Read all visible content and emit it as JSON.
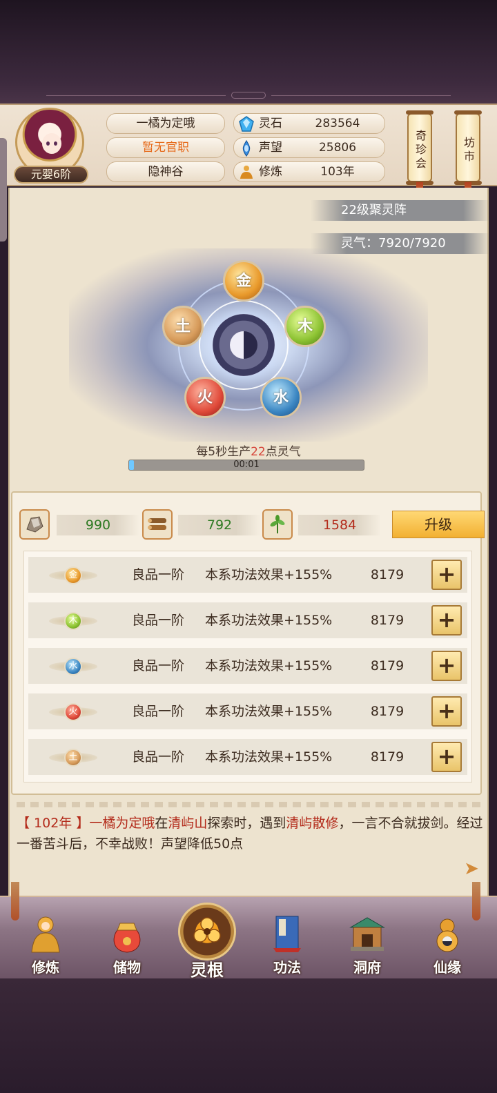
{
  "player": {
    "name": "一橘为定哦",
    "official_title": "暂无官职",
    "sect": "隐神谷",
    "rank": "元婴6阶"
  },
  "resources": [
    {
      "label": "灵石",
      "value": "283564",
      "icon": "spirit-stone-icon"
    },
    {
      "label": "声望",
      "value": "25806",
      "icon": "reputation-icon"
    },
    {
      "label": "修炼",
      "value": "103年",
      "icon": "meditation-icon"
    }
  ],
  "scrolls": {
    "treasure_shop": "奇珍会",
    "market": "坊市"
  },
  "array": {
    "level_label": "22级聚灵阵",
    "qi_label": "灵气：7920/7920",
    "production_prefix": "每5秒生产",
    "production_amount": "22",
    "production_suffix": "点灵气",
    "timer": "00:01",
    "progress": 0.02
  },
  "elements": {
    "gold": "金",
    "wood": "木",
    "water": "水",
    "fire": "火",
    "earth": "土"
  },
  "materials": [
    {
      "value": "990",
      "icon": "ore-icon"
    },
    {
      "value": "792",
      "icon": "wood-log-icon"
    },
    {
      "value": "1584",
      "icon": "herb-icon"
    }
  ],
  "upgrade_label": "升级",
  "element_rows": [
    {
      "element": "金",
      "grade": "良品一阶",
      "effect": "本系功法效果+155%",
      "cost": "8179"
    },
    {
      "element": "木",
      "grade": "良品一阶",
      "effect": "本系功法效果+155%",
      "cost": "8179"
    },
    {
      "element": "水",
      "grade": "良品一阶",
      "effect": "本系功法效果+155%",
      "cost": "8179"
    },
    {
      "element": "火",
      "grade": "良品一阶",
      "effect": "本系功法效果+155%",
      "cost": "8179"
    },
    {
      "element": "土",
      "grade": "良品一阶",
      "effect": "本系功法效果+155%",
      "cost": "8179"
    }
  ],
  "plus_label": "+",
  "log": {
    "year": "【 102年 】",
    "actor": "一橘为定哦",
    "t1": "在",
    "place": "清屿山",
    "t2": "探索时，遇到",
    "enemy": "清屿散修",
    "t3": "，一言不合就拔剑。经过一番苦斗后，不幸战败！声望降低50点"
  },
  "nav": [
    {
      "label": "修炼",
      "icon": "meditate-icon"
    },
    {
      "label": "储物",
      "icon": "bag-icon"
    },
    {
      "label": "灵根",
      "icon": "spirit-root-icon"
    },
    {
      "label": "功法",
      "icon": "book-icon"
    },
    {
      "label": "洞府",
      "icon": "cave-house-icon"
    },
    {
      "label": "仙缘",
      "icon": "gourd-icon"
    }
  ]
}
